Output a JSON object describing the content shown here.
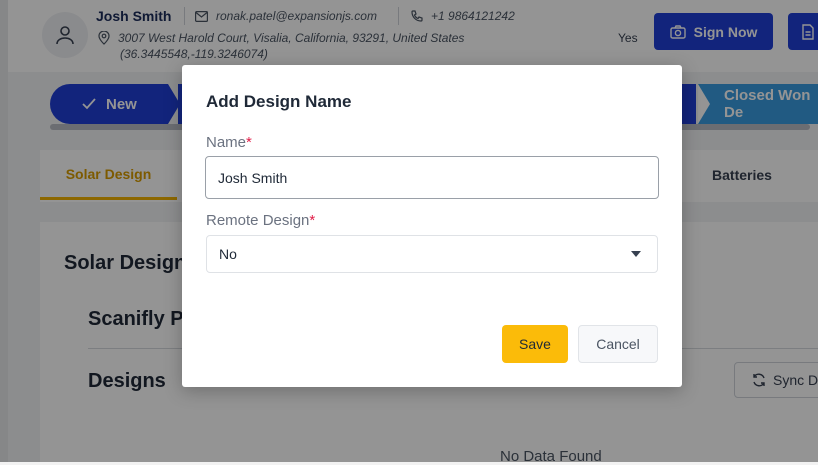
{
  "header": {
    "customer_name": "Josh Smith",
    "email": "ronak.patel@expansionjs.com",
    "phone": "+1 9864121242",
    "address_line": "3007 West Harold Court, Visalia, California, 93291, United States",
    "address_coords": "(36.3445548,-119.3246074)",
    "flag_value": "Yes",
    "sign_button_label": "Sign Now"
  },
  "stages": {
    "first_label": "New",
    "last_label": "Closed Won De"
  },
  "tabs": {
    "active_label": "Solar Design",
    "batteries_label": "Batteries"
  },
  "content": {
    "section_title": "Solar Design",
    "scanifly_title": "Scanifly P",
    "designs_title": "Designs",
    "sync_button_label": "Sync D",
    "empty_text": "No Data Found"
  },
  "modal": {
    "title": "Add Design Name",
    "name_label": "Name",
    "name_value": "Josh Smith",
    "remote_label": "Remote Design",
    "required_mark": "*",
    "remote_selected": "No",
    "save_label": "Save",
    "cancel_label": "Cancel"
  },
  "colors": {
    "primary": "#1f3fd6",
    "accent": "#fbbb09",
    "closed_stage": "#3a9be0"
  }
}
